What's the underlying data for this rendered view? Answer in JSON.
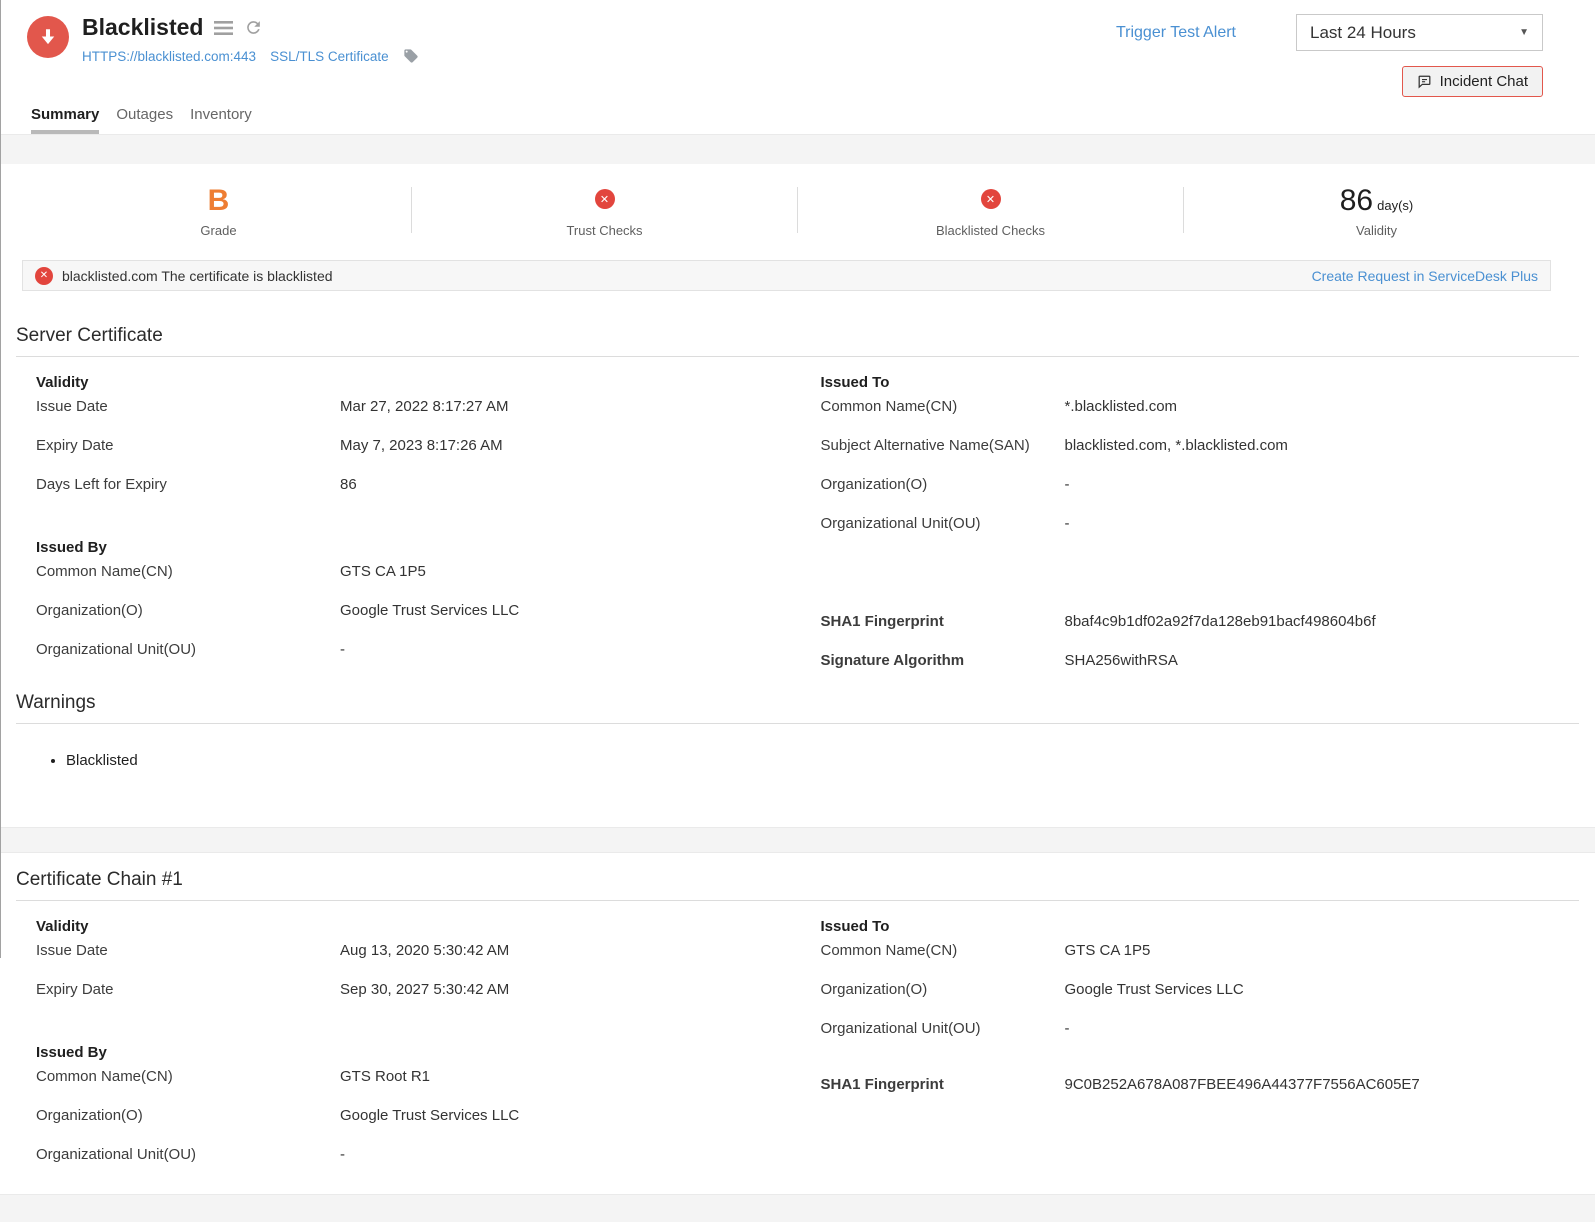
{
  "header": {
    "title": "Blacklisted",
    "url_link": "HTTPS://blacklisted.com:443",
    "type_link": "SSL/TLS Certificate",
    "trigger_test_alert": "Trigger Test Alert",
    "time_range": "Last 24 Hours",
    "incident_chat_label": "Incident Chat",
    "tabs": [
      {
        "label": "Summary",
        "active": true
      },
      {
        "label": "Outages",
        "active": false
      },
      {
        "label": "Inventory",
        "active": false
      }
    ]
  },
  "stats": {
    "grade": {
      "value": "B",
      "label": "Grade"
    },
    "trust_checks": {
      "label": "Trust Checks",
      "status": "error"
    },
    "blacklisted_checks": {
      "label": "Blacklisted Checks",
      "status": "error"
    },
    "validity": {
      "value": "86",
      "unit": "day(s)",
      "label": "Validity"
    }
  },
  "alert": {
    "message": "blacklisted.com The certificate is blacklisted",
    "action_link": "Create Request in ServiceDesk Plus"
  },
  "server_certificate": {
    "heading": "Server Certificate",
    "validity": {
      "heading": "Validity",
      "rows": [
        {
          "label": "Issue Date",
          "value": "Mar 27, 2022 8:17:27 AM"
        },
        {
          "label": "Expiry Date",
          "value": "May 7, 2023 8:17:26 AM"
        },
        {
          "label": "Days Left for Expiry",
          "value": "86"
        }
      ]
    },
    "issued_to": {
      "heading": "Issued To",
      "rows": [
        {
          "label": "Common Name(CN)",
          "value": "*.blacklisted.com"
        },
        {
          "label": "Subject Alternative Name(SAN)",
          "value": "blacklisted.com, *.blacklisted.com"
        },
        {
          "label": "Organization(O)",
          "value": "-"
        },
        {
          "label": "Organizational Unit(OU)",
          "value": "-"
        }
      ]
    },
    "issued_by": {
      "heading": "Issued By",
      "rows": [
        {
          "label": "Common Name(CN)",
          "value": "GTS CA 1P5"
        },
        {
          "label": "Organization(O)",
          "value": "Google Trust Services LLC"
        },
        {
          "label": "Organizational Unit(OU)",
          "value": "-"
        }
      ]
    },
    "fingerprint": {
      "rows": [
        {
          "label": "SHA1 Fingerprint",
          "value": "8baf4c9b1df02a92f7da128eb91bacf498604b6f"
        },
        {
          "label": "Signature Algorithm",
          "value": "SHA256withRSA"
        }
      ]
    }
  },
  "warnings": {
    "heading": "Warnings",
    "items": [
      "Blacklisted"
    ]
  },
  "certificate_chain": {
    "heading": "Certificate Chain #1",
    "validity": {
      "heading": "Validity",
      "rows": [
        {
          "label": "Issue Date",
          "value": "Aug 13, 2020 5:30:42 AM"
        },
        {
          "label": "Expiry Date",
          "value": "Sep 30, 2027 5:30:42 AM"
        }
      ]
    },
    "issued_to": {
      "heading": "Issued To",
      "rows": [
        {
          "label": "Common Name(CN)",
          "value": "GTS CA 1P5"
        },
        {
          "label": "Organization(O)",
          "value": "Google Trust Services LLC"
        },
        {
          "label": "Organizational Unit(OU)",
          "value": "-"
        }
      ]
    },
    "issued_by": {
      "heading": "Issued By",
      "rows": [
        {
          "label": "Common Name(CN)",
          "value": "GTS Root R1"
        },
        {
          "label": "Organization(O)",
          "value": "Google Trust Services LLC"
        },
        {
          "label": "Organizational Unit(OU)",
          "value": "-"
        }
      ]
    },
    "fingerprint": {
      "rows": [
        {
          "label": "SHA1 Fingerprint",
          "value": "9C0B252A678A087FBEE496A44377F7556AC605E7"
        }
      ]
    }
  },
  "colors": {
    "status_red": "#e2574c",
    "error_red": "#e2453d",
    "grade_orange": "#ee7d32",
    "link_blue": "#4a90d2",
    "incident_chat_border": "#e2574c"
  },
  "icons": {
    "monitor_status": "down-arrow-in-red-circle",
    "menu": "hamburger",
    "refresh": "refresh",
    "tag": "tag",
    "time_range": "caret-down",
    "incident_chat": "chat-bubble",
    "check_status": "x-circle"
  }
}
